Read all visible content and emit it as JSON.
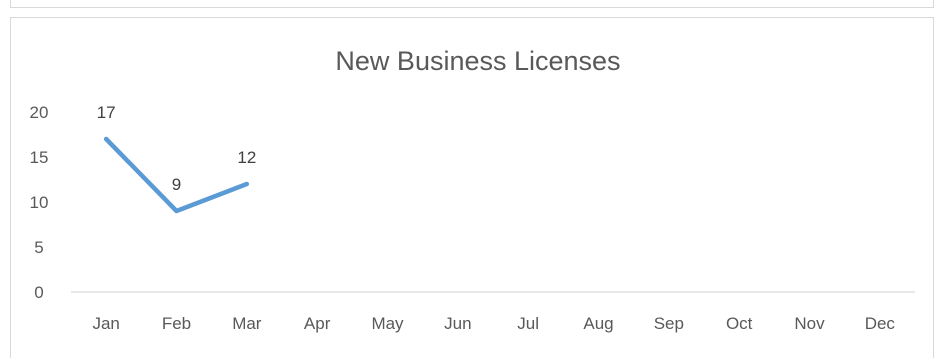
{
  "chart_data": {
    "type": "line",
    "title": "New Business Licenses",
    "xlabel": "",
    "ylabel": "",
    "categories": [
      "Jan",
      "Feb",
      "Mar",
      "Apr",
      "May",
      "Jun",
      "Jul",
      "Aug",
      "Sep",
      "Oct",
      "Nov",
      "Dec"
    ],
    "series": [
      {
        "values": [
          17,
          9,
          12,
          null,
          null,
          null,
          null,
          null,
          null,
          null,
          null,
          null
        ],
        "color": "#5b9bd5"
      }
    ],
    "data_labels": true,
    "ylim": [
      0,
      20
    ],
    "yticks": [
      "0",
      "5",
      "10",
      "15",
      "20"
    ],
    "grid": false,
    "legend": "none",
    "colors": {
      "line": "#5b9bd5",
      "text": "#595959",
      "axis": "#d9d9d9"
    }
  }
}
